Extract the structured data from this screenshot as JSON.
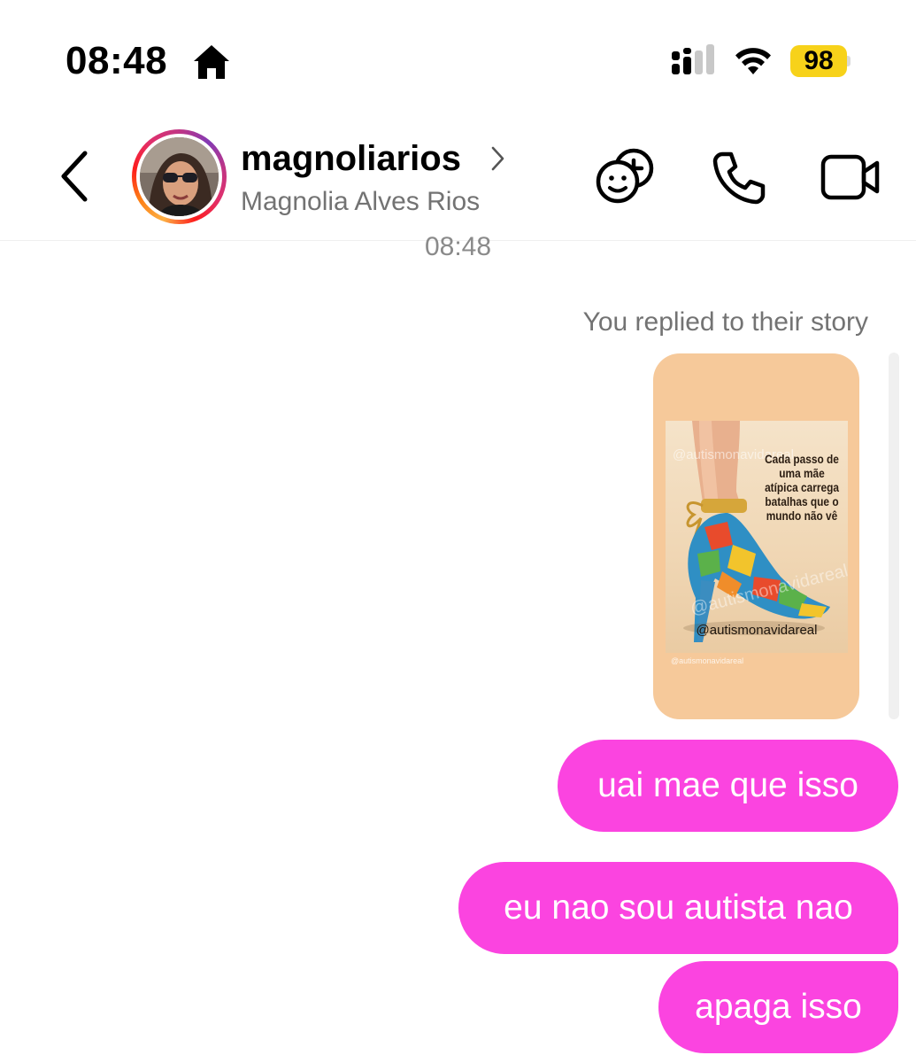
{
  "status_bar": {
    "time": "08:48",
    "battery_level": "98",
    "battery_color": "#f7d21a"
  },
  "header": {
    "username": "magnoliarios",
    "full_name": "Magnolia Alves Rios",
    "icons": [
      "back-icon",
      "chevron-right-icon",
      "add-people-icon",
      "phone-icon",
      "video-icon"
    ]
  },
  "chat": {
    "timestamp": "08:48",
    "replied_label": "You replied to their story",
    "story": {
      "caption": "Cada passo de uma mãe atípica carrega batalhas que o mundo não vê",
      "handle": "@autismonavidareal",
      "watermark": "@autismonavidareal",
      "watermark_2": "@autismonavidareal",
      "footer_handle": "@autismonavidareal"
    },
    "messages": [
      {
        "text": "uai mae que isso",
        "sender": "me"
      },
      {
        "text": "eu nao sou autista nao",
        "sender": "me"
      },
      {
        "text": "apaga isso",
        "sender": "me"
      }
    ],
    "bubble_color": "#fb44e0"
  }
}
